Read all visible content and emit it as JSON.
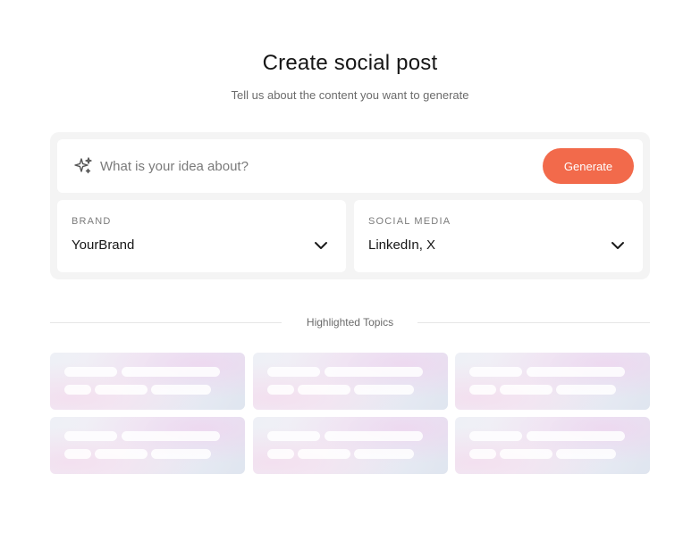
{
  "header": {
    "title": "Create social post",
    "subtitle": "Tell us about the content you want to generate"
  },
  "idea": {
    "icon": "sparkle-icon",
    "placeholder": "What is your idea about?",
    "value": "",
    "generate_label": "Generate",
    "accent_color": "#f26a4b"
  },
  "brand": {
    "label": "BRAND",
    "value": "YourBrand",
    "icon": "chevron-down-icon"
  },
  "social_media": {
    "label": "SOCIAL MEDIA",
    "value": "LinkedIn, X",
    "icon": "chevron-down-icon"
  },
  "topics": {
    "heading": "Highlighted Topics",
    "state": "loading-skeleton",
    "card_count": 6
  }
}
